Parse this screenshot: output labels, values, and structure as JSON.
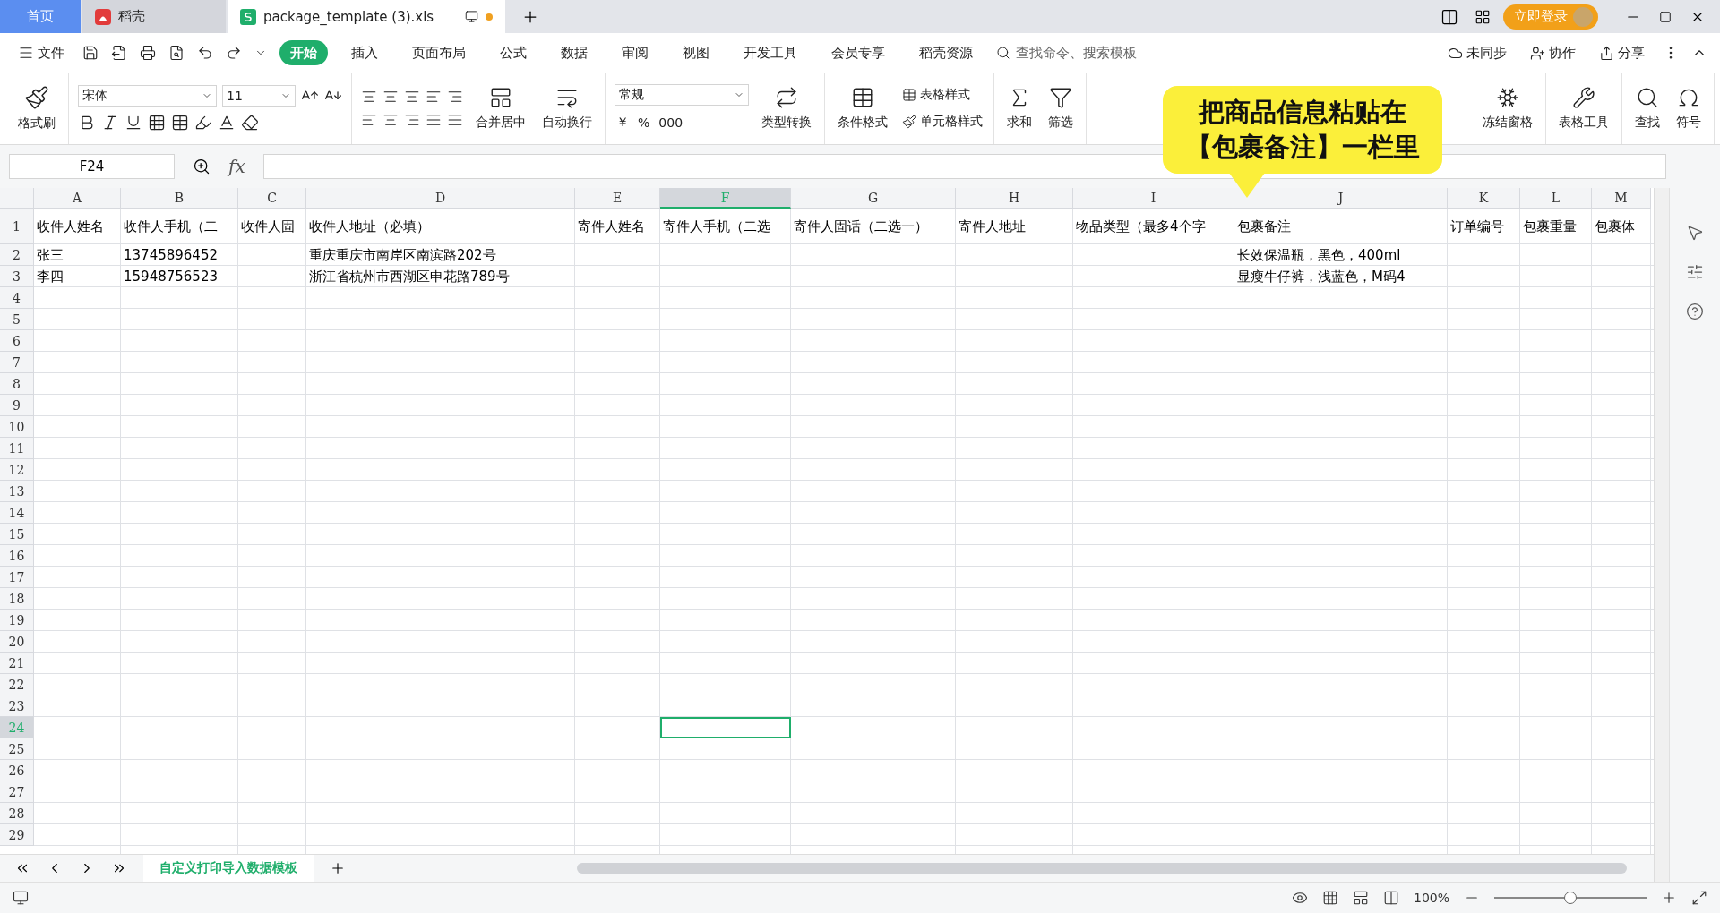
{
  "title_tabs": [
    {
      "label": "首页",
      "kind": "home",
      "selected": false
    },
    {
      "label": "稻壳",
      "kind": "app",
      "selected": false
    },
    {
      "label": "package_template (3).xls",
      "kind": "doc",
      "selected": true
    }
  ],
  "account": {
    "login": "立即登录"
  },
  "menu": {
    "file": "文件",
    "tabs": [
      {
        "label": "开始",
        "selected": true
      },
      {
        "label": "插入",
        "selected": false
      },
      {
        "label": "页面布局",
        "selected": false
      },
      {
        "label": "公式",
        "selected": false
      },
      {
        "label": "数据",
        "selected": false
      },
      {
        "label": "审阅",
        "selected": false
      },
      {
        "label": "视图",
        "selected": false
      },
      {
        "label": "开发工具",
        "selected": false
      },
      {
        "label": "会员专享",
        "selected": false
      },
      {
        "label": "稻壳资源",
        "selected": false
      }
    ],
    "search": {
      "placeholder": "查找命令、搜索模板"
    },
    "actions": [
      "未同步",
      "协作",
      "分享"
    ]
  },
  "ribbon": {
    "format_painter": "格式刷",
    "font": "宋体",
    "font_size": "11",
    "merge": "合并居中",
    "wrap": "自动换行",
    "number_format": "常规",
    "currency": "￥",
    "percent": "%",
    "thousands": "000",
    "convert": "类型转换",
    "conditional": "条件格式",
    "table_style": "表格样式",
    "cell_style": "单元格样式",
    "sum": "求和",
    "filter": "筛选",
    "freeze": "冻结窗格",
    "table_tools": "表格工具",
    "find": "查找",
    "symbol": "符号"
  },
  "callout": {
    "lines": [
      "把商品信息粘贴在",
      "【包裹备注】一栏里"
    ]
  },
  "name_box": "F24",
  "formula_label": "fx",
  "columns": [
    {
      "label": "A",
      "selected": false
    },
    {
      "label": "B",
      "selected": false
    },
    {
      "label": "C",
      "selected": false
    },
    {
      "label": "D",
      "selected": false
    },
    {
      "label": "E",
      "selected": false
    },
    {
      "label": "F",
      "selected": true
    },
    {
      "label": "G",
      "selected": false
    },
    {
      "label": "H",
      "selected": false
    },
    {
      "label": "I",
      "selected": false
    },
    {
      "label": "J",
      "selected": false
    },
    {
      "label": "K",
      "selected": false
    },
    {
      "label": "L",
      "selected": false
    },
    {
      "label": "M",
      "selected": false
    }
  ],
  "rows": [
    {
      "number": "1",
      "selected": false,
      "cells": {
        "A": "收件人姓名",
        "B": "收件人手机（二",
        "C": "收件人固",
        "D": "收件人地址（必填）",
        "E": "寄件人姓名",
        "F": "寄件人手机（二选",
        "G": "寄件人固话（二选一）",
        "H": "寄件人地址",
        "I": "物品类型（最多4个字",
        "J": "包裹备注",
        "K": "订单编号",
        "L": "包裹重量",
        "M": "包裹体"
      }
    },
    {
      "number": "2",
      "selected": false,
      "cells": {
        "A": "张三",
        "B": "13745896452",
        "D": "重庆重庆市南岸区南滨路202号",
        "J": "长效保温瓶，黑色，400ml"
      }
    },
    {
      "number": "3",
      "selected": false,
      "cells": {
        "A": "李四",
        "B": "15948756523",
        "D": "浙江省杭州市西湖区申花路789号",
        "J": "显瘦牛仔裤，浅蓝色，M码4"
      }
    },
    {
      "number": "4",
      "selected": false
    },
    {
      "number": "5",
      "selected": false
    },
    {
      "number": "6",
      "selected": false
    },
    {
      "number": "7",
      "selected": false
    },
    {
      "number": "8",
      "selected": false
    },
    {
      "number": "9",
      "selected": false
    },
    {
      "number": "10",
      "selected": false
    },
    {
      "number": "11",
      "selected": false
    },
    {
      "number": "12",
      "selected": false
    },
    {
      "number": "13",
      "selected": false
    },
    {
      "number": "14",
      "selected": false
    },
    {
      "number": "15",
      "selected": false
    },
    {
      "number": "16",
      "selected": false
    },
    {
      "number": "17",
      "selected": false
    },
    {
      "number": "18",
      "selected": false
    },
    {
      "number": "19",
      "selected": false
    },
    {
      "number": "20",
      "selected": false
    },
    {
      "number": "21",
      "selected": false
    },
    {
      "number": "22",
      "selected": false
    },
    {
      "number": "23",
      "selected": false
    },
    {
      "number": "24",
      "selected": true
    },
    {
      "number": "25",
      "selected": false
    },
    {
      "number": "26",
      "selected": false
    },
    {
      "number": "27",
      "selected": false
    },
    {
      "number": "28",
      "selected": false
    },
    {
      "number": "29",
      "selected": false
    }
  ],
  "sheet_tabs": [
    {
      "label": "自定义打印导入数据模板",
      "selected": true
    }
  ],
  "status": {
    "zoom": "100%",
    "zoom_slider": {
      "level": 0.5
    }
  }
}
